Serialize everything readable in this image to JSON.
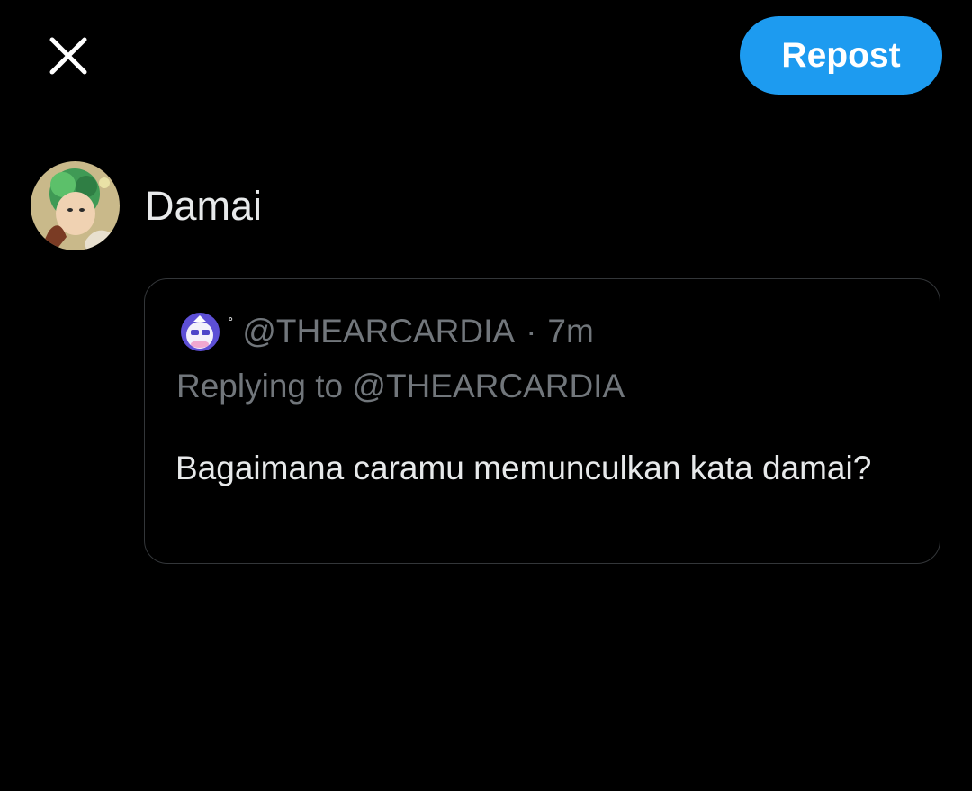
{
  "header": {
    "close_icon": "close-icon",
    "repost_label": "Repost",
    "accent_color": "#1d9bf0"
  },
  "composer": {
    "text": "Damai",
    "avatar_icon": "user-avatar"
  },
  "quoted_post": {
    "display_name": "˚",
    "handle": "@THEARCARDIA",
    "separator": "·",
    "time": "7m",
    "replying_to": "Replying to @THEARCARDIA",
    "body": "Bagaimana caramu memunculkan kata damai?",
    "avatar_icon": "quoted-user-avatar"
  }
}
